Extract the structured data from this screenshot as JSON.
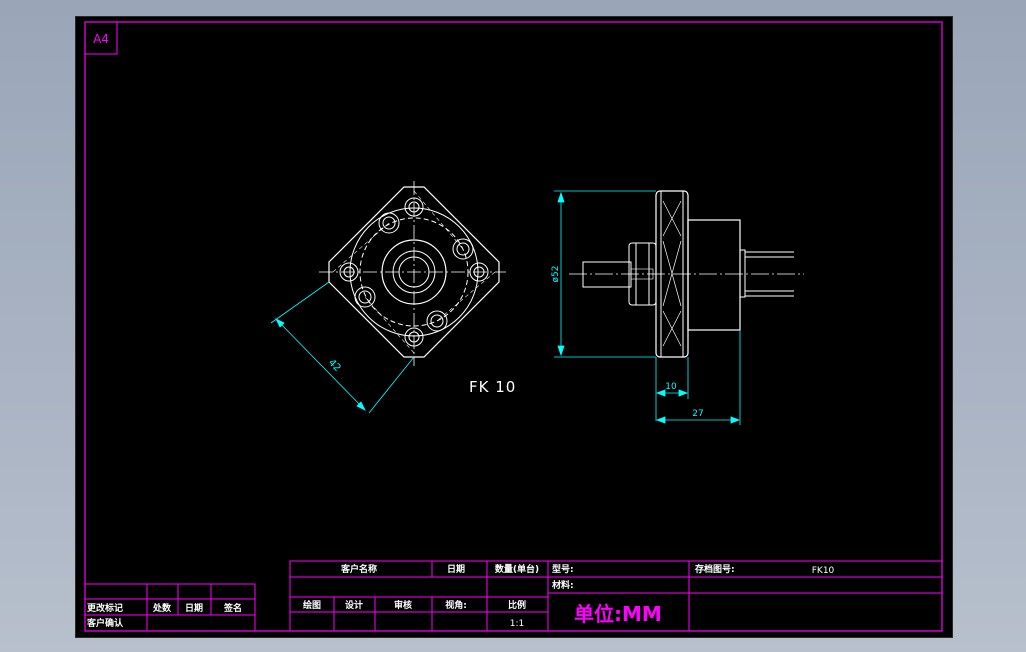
{
  "sheet": {
    "size_label": "A4",
    "colors": {
      "background": "#000000",
      "frame": "#ff00ff",
      "geometry": "#ffffff",
      "dimension": "#00ffff",
      "unit_text": "#ff00ff"
    }
  },
  "drawing": {
    "part_label": "FK 10",
    "dimensions": {
      "square_size": "42",
      "diameter": "ø52",
      "flange_thickness": "10",
      "overall_length": "27"
    }
  },
  "title_block": {
    "customer_name": "客户名称",
    "date": "日期",
    "quantity": "数量(单台)",
    "model_no": "型号:",
    "storage_no": "存档图号:",
    "storage_value": "FK10",
    "material": "材料:",
    "draw": "绘图",
    "design": "设计",
    "review": "审核",
    "view_angle": "视角:",
    "ratio": "比例",
    "ratio_value": "1:1",
    "unit": "单位:MM"
  },
  "revision_block": {
    "change_mark": "更改标记",
    "count": "处数",
    "date": "日期",
    "sign": "签名",
    "customer_confirm": "客户确认"
  }
}
